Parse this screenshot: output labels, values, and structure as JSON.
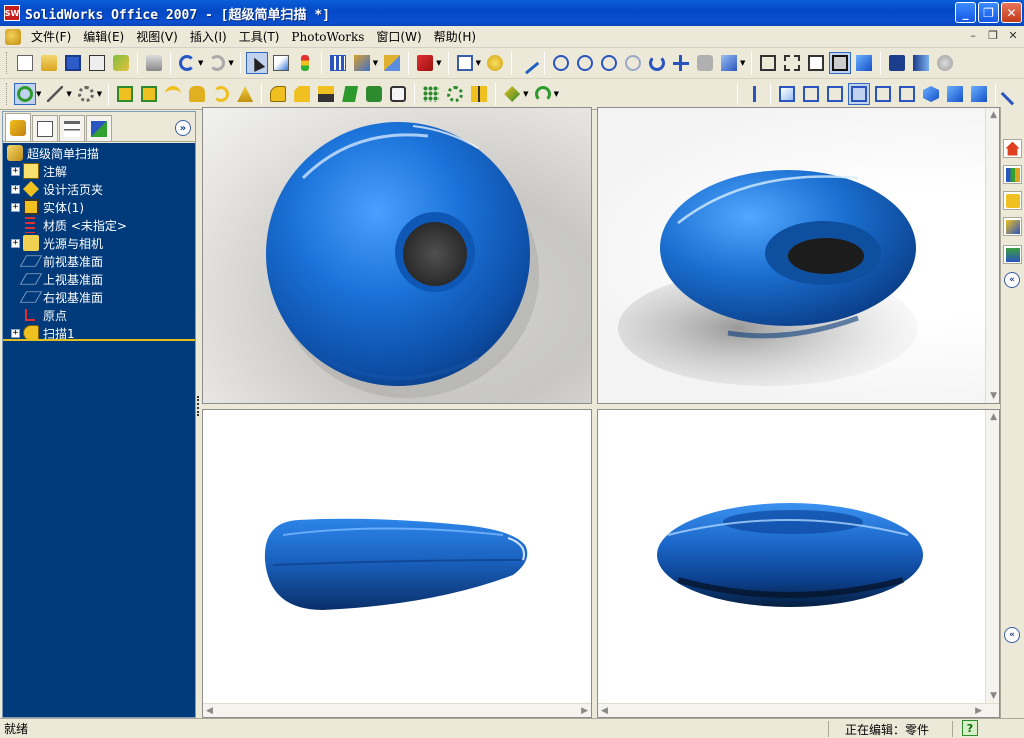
{
  "window": {
    "title": "SolidWorks Office 2007 - [超级简单扫描 *]",
    "logo_text": "SW",
    "controls": {
      "minimize": "_",
      "maximize": "❐",
      "close": "✕"
    }
  },
  "menu": {
    "items": [
      {
        "label": "文件(F)",
        "name": "menu-file"
      },
      {
        "label": "编辑(E)",
        "name": "menu-edit"
      },
      {
        "label": "视图(V)",
        "name": "menu-view"
      },
      {
        "label": "插入(I)",
        "name": "menu-insert"
      },
      {
        "label": "工具(T)",
        "name": "menu-tools"
      },
      {
        "label": "PhotoWorks",
        "name": "menu-photoworks"
      },
      {
        "label": "窗口(W)",
        "name": "menu-window"
      },
      {
        "label": "帮助(H)",
        "name": "menu-help"
      }
    ],
    "mdi_controls": {
      "minimize": "–",
      "restore": "❐",
      "close": "✕"
    }
  },
  "feature_tree": {
    "root": "超级简单扫描",
    "items": [
      {
        "label": "注解",
        "icon": "annotations-icon",
        "expandable": true
      },
      {
        "label": "设计活页夹",
        "icon": "design-binder-icon",
        "expandable": true
      },
      {
        "label": "实体(1)",
        "icon": "solid-bodies-icon",
        "expandable": true
      },
      {
        "label": "材质 <未指定>",
        "icon": "material-icon",
        "expandable": false
      },
      {
        "label": "光源与相机",
        "icon": "lights-cameras-icon",
        "expandable": true
      },
      {
        "label": "前视基准面",
        "icon": "plane-icon",
        "expandable": false
      },
      {
        "label": "上视基准面",
        "icon": "plane-icon",
        "expandable": false
      },
      {
        "label": "右视基准面",
        "icon": "plane-icon",
        "expandable": false
      },
      {
        "label": "原点",
        "icon": "origin-icon",
        "expandable": false
      },
      {
        "label": "扫描1",
        "icon": "sweep-feature-icon",
        "expandable": true
      }
    ]
  },
  "status": {
    "left": "就绪",
    "edit_state": "正在编辑：零件",
    "help": "?"
  },
  "colors": {
    "model_blue": "#1a6fd0",
    "tree_background": "#003a7a",
    "title_bar": "#0349c6"
  },
  "icons": {
    "toolbar1": [
      "new-icon",
      "open-icon",
      "save-icon",
      "print-preview-icon",
      "options-icon",
      "print-icon",
      "undo-icon",
      "redo-icon",
      "select-icon",
      "select-filter-icon",
      "traffic-light-icon",
      "grid-icon",
      "view-orientation-icon",
      "section-view-icon",
      "appearance-icon",
      "display-style-icon",
      "help-icon",
      "sketch-icon",
      "zoom-fit-icon",
      "zoom-area-icon",
      "zoom-in-out-icon",
      "zoom-selection-icon",
      "rotate-icon",
      "pan-icon",
      "roll-icon",
      "shaded-icon",
      "wireframe-icon",
      "hidden-lines-visible-icon",
      "hidden-lines-removed-icon",
      "shaded-with-edges-icon",
      "shaded-view-icon",
      "shadows-icon",
      "perspective-icon",
      "realview-icon"
    ],
    "toolbar2": [
      "sketch-tools-icon",
      "relations-icon",
      "features-icon",
      "extrude-icon",
      "cut-icon",
      "revolve-icon",
      "sweep-icon",
      "loft-icon",
      "fillet-icon",
      "chamfer-icon",
      "shell-icon",
      "rib-icon",
      "draft-icon",
      "hole-icon",
      "pattern-icon",
      "mirror-icon",
      "surfaces-icon",
      "reference-geometry-icon",
      "curves-icon",
      "normal-to-icon",
      "front-view-icon",
      "back-view-icon",
      "left-view-icon",
      "right-view-icon",
      "top-view-icon",
      "bottom-view-icon",
      "isometric-icon",
      "trimetric-icon",
      "dimetric-icon",
      "display-pane-icon"
    ]
  }
}
